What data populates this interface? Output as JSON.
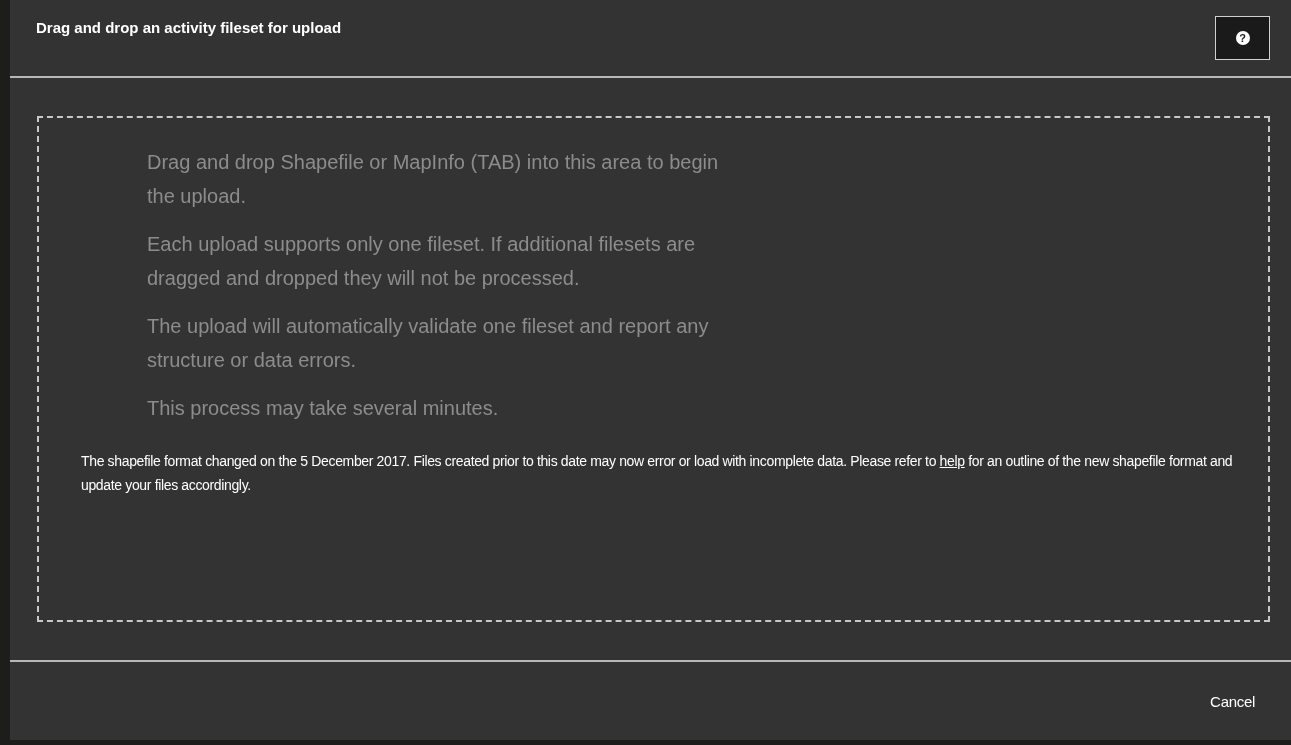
{
  "dialog": {
    "title": "Drag and drop an activity fileset for upload",
    "help_button": {
      "icon": "?"
    },
    "dropzone": {
      "instructions": [
        "Drag and drop Shapefile or MapInfo (TAB) into this area to begin the upload.",
        "Each upload supports only one fileset. If additional filesets are dragged and dropped they will not be processed.",
        "The upload will automatically validate one fileset and report any structure or data errors.",
        "This process may take several minutes."
      ],
      "notice": {
        "text_before": "The shapefile format changed on the 5 December 2017. Files created prior to this date may now error or load with incomplete data. Please refer to ",
        "link": "help",
        "text_after": " for an outline of the new shapefile format and update your files accordingly."
      }
    },
    "buttons": [
      {
        "label": "Cancel"
      }
    ]
  }
}
